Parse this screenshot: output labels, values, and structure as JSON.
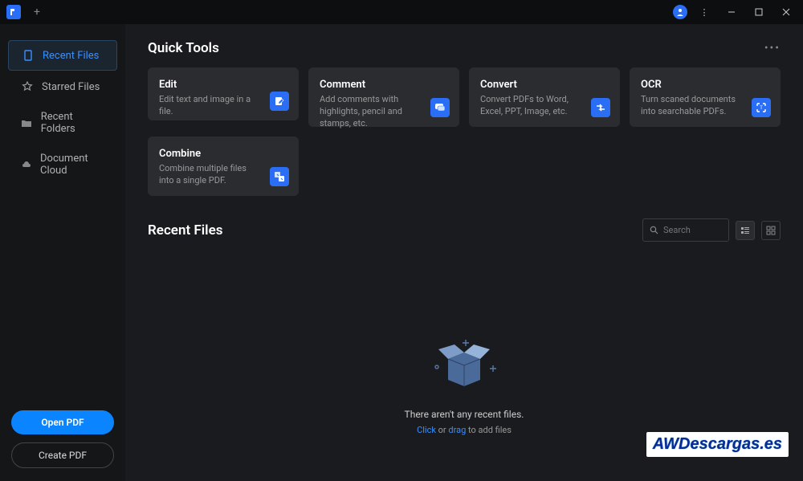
{
  "titlebar": {
    "avatar_icon": "user"
  },
  "sidebar": {
    "items": [
      {
        "label": "Recent Files",
        "icon": "file"
      },
      {
        "label": "Starred Files",
        "icon": "star"
      },
      {
        "label": "Recent Folders",
        "icon": "folder"
      },
      {
        "label": "Document Cloud",
        "icon": "cloud"
      }
    ],
    "open_btn": "Open PDF",
    "create_btn": "Create PDF"
  },
  "quick_tools": {
    "title": "Quick Tools",
    "cards": [
      {
        "title": "Edit",
        "desc": "Edit text and image in a file."
      },
      {
        "title": "Comment",
        "desc": "Add comments with highlights, pencil and stamps, etc."
      },
      {
        "title": "Convert",
        "desc": "Convert PDFs to Word, Excel, PPT, Image, etc."
      },
      {
        "title": "OCR",
        "desc": "Turn scaned documents into searchable PDFs."
      },
      {
        "title": "Combine",
        "desc": "Combine multiple files into a single PDF."
      }
    ]
  },
  "recent": {
    "title": "Recent Files",
    "search_placeholder": "Search",
    "empty_title": "There aren't any recent files.",
    "empty_click": "Click",
    "empty_or": " or ",
    "empty_drag": "drag",
    "empty_tail": " to add files"
  },
  "watermark": "AWDescargas.es"
}
